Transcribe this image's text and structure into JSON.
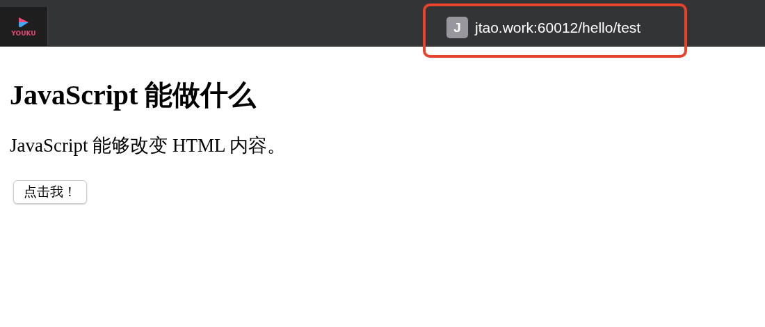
{
  "tab": {
    "logo_text": "YOUKU"
  },
  "address": {
    "favicon_letter": "J",
    "url": "jtao.work:60012/hello/test",
    "highlighted": true
  },
  "page": {
    "heading": "JavaScript 能做什么",
    "paragraph": "JavaScript 能够改变 HTML 内容。",
    "button": "点击我！"
  }
}
